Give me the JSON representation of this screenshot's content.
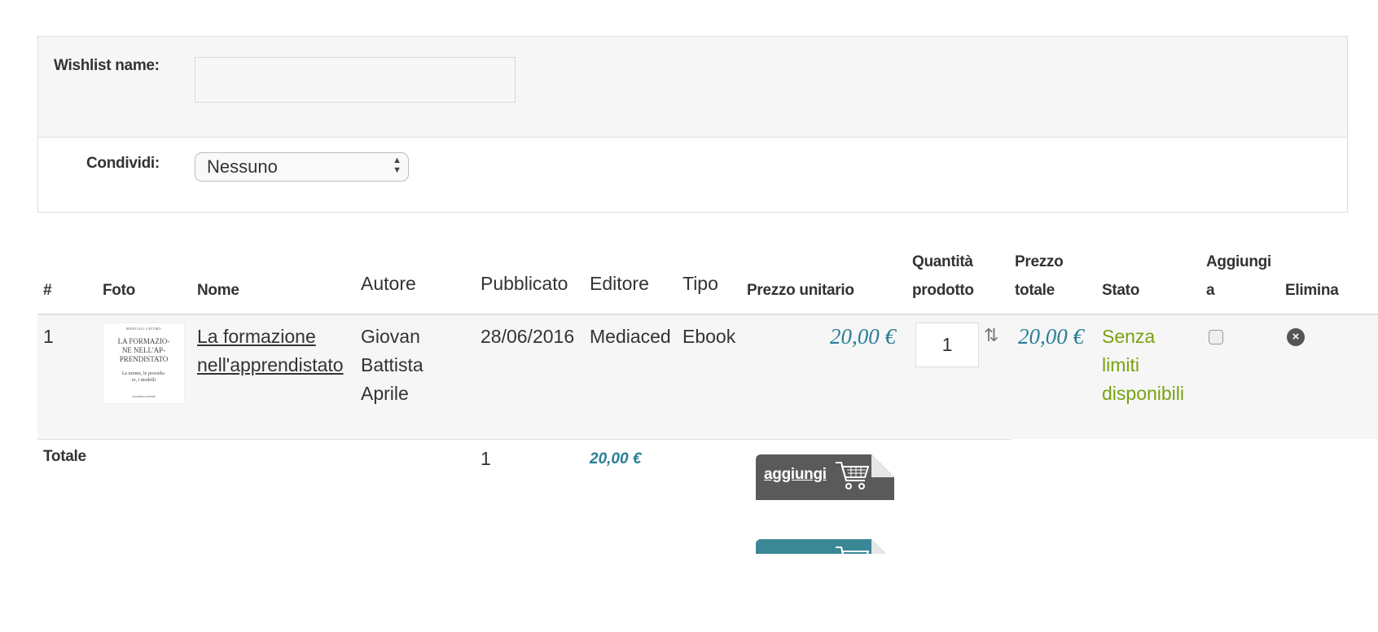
{
  "form": {
    "wishlist_label": "Wishlist name:",
    "wishlist_value": "",
    "share_label": "Condividi:",
    "share_value": "Nessuno"
  },
  "table": {
    "headers": {
      "num": "#",
      "photo": "Foto",
      "name": "Nome",
      "author": "Autore",
      "published": "Pubblicato",
      "publisher": "Editore",
      "type": "Tipo",
      "unit_price": "Prezzo unitario",
      "quantity_l1": "Quantità",
      "quantity_l2": "prodotto",
      "total_price_l1": "Prezzo",
      "total_price_l2": "totale",
      "status": "Stato",
      "add_to_l1": "Aggiungi",
      "add_to_l2": "a",
      "delete": "Elimina"
    },
    "rows": [
      {
        "num": "1",
        "cover": {
          "publisher": "MANUALI LAVORO",
          "title": "LA FORMAZIO-\nNE NELL'AP-\nPRENDISTATO",
          "subtitle": "Le norme, le procedu-\nre, i modelli",
          "footer": "DOTTRINA GIUFFRÈ"
        },
        "name_l1": "La formazione",
        "name_l2": "nell'apprendistato",
        "author_l1": "Giovan",
        "author_l2": "Battista",
        "author_l3": "Aprile",
        "published": "28/06/2016",
        "publisher": "Mediaced",
        "type": "Ebook",
        "unit_price": "20,00 €",
        "quantity": "1",
        "total_price": "20,00 €",
        "status_l1": "Senza",
        "status_l2": "limiti",
        "status_l3": "disponibili"
      }
    ],
    "totals": {
      "label": "Totale",
      "quantity": "1",
      "price": "20,00 €",
      "cart_button_label": "aggiungi"
    }
  },
  "colors": {
    "price": "#2a7e99",
    "status_available": "#7aa112",
    "cart_dark": "#5a5a5a",
    "cart_teal": "#3a8796"
  }
}
